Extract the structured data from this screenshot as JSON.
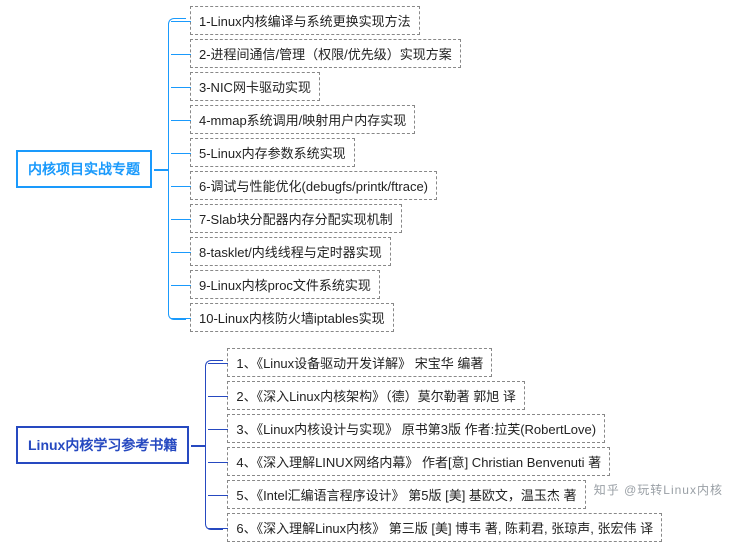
{
  "sections": [
    {
      "title": "内核项目实战专题",
      "colorClass": "1",
      "items": [
        "1-Linux内核编译与系统更换实现方法",
        "2-进程间通信/管理（权限/优先级）实现方案",
        "3-NIC网卡驱动实现",
        "4-mmap系统调用/映射用户内存实现",
        "5-Linux内存参数系统实现",
        "6-调试与性能优化(debugfs/printk/ftrace)",
        "7-Slab块分配器内存分配实现机制",
        "8-tasklet/内线线程与定时器实现",
        "9-Linux内核proc文件系统实现",
        "10-Linux内核防火墙iptables实现"
      ]
    },
    {
      "title": "Linux内核学习参考书籍",
      "colorClass": "2",
      "items": [
        "1、《Linux设备驱动开发详解》 宋宝华 编著",
        "2、《深入Linux内核架构》（德）莫尔勒著 郭旭 译",
        "3、《Linux内核设计与实现》 原书第3版 作者:拉芙(RobertLove)",
        "4、《深入理解LINUX网络内幕》 作者[意] Christian Benvenuti 著",
        "5、《Intel汇编语言程序设计》 第5版 [美] 基欧文，温玉杰 著",
        "6、《深入理解Linux内核》 第三版 [美] 博韦 著, 陈莉君, 张琼声, 张宏伟 译"
      ]
    }
  ],
  "watermark": "知乎 @玩转Linux内核"
}
